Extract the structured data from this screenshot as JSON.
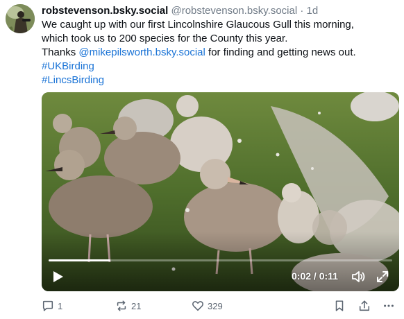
{
  "post": {
    "author": {
      "display_name": "robstevenson.bsky.social",
      "handle": "@robstevenson.bsky.social",
      "separator": "·",
      "timestamp": "1d"
    },
    "text": {
      "line1": "We caught up with our first Lincolnshire Glaucous Gull this morning,",
      "line2": "which took us to 200 species for the County this year.",
      "line3_before": "Thanks ",
      "mention": "@mikepilsworth.bsky.social",
      "line3_after": " for finding and getting news out.",
      "hashtag1": "#UKBirding",
      "hashtag2": "#LincsBirding"
    },
    "video": {
      "time_readout": "0:02 / 0:11",
      "progress_fraction": 0.18,
      "play_icon": "play-icon",
      "volume_icon": "volume-icon",
      "fullscreen_icon": "fullscreen-icon"
    },
    "actions": {
      "replies": "1",
      "reposts": "21",
      "likes": "329"
    },
    "colors": {
      "link": "#1a73d6",
      "muted_text": "#6f7a86",
      "icon_gray": "#5a6470"
    }
  }
}
